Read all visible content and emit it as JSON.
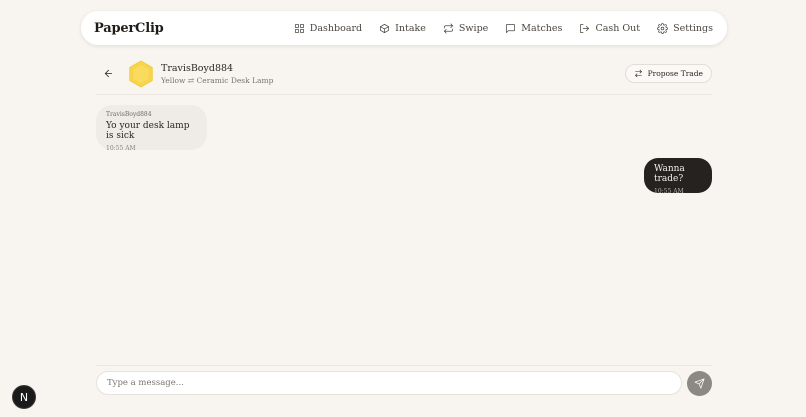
{
  "brand": "PaperClip",
  "nav": [
    {
      "label": "Dashboard",
      "icon": "dashboard-icon"
    },
    {
      "label": "Intake",
      "icon": "box-icon"
    },
    {
      "label": "Swipe",
      "icon": "repeat-icon"
    },
    {
      "label": "Matches",
      "icon": "message-icon"
    },
    {
      "label": "Cash Out",
      "icon": "logout-icon"
    },
    {
      "label": "Settings",
      "icon": "gear-icon"
    }
  ],
  "chat": {
    "partner_name": "TravisBoyd884",
    "trade_summary": "Yellow ⇄ Ceramic Desk Lamp",
    "avatar_color": "#f7d54a",
    "propose_label": "Propose Trade"
  },
  "messages": [
    {
      "direction": "incoming",
      "sender": "TravisBoyd884",
      "text": "Yo your desk lamp is sick",
      "time": "10:55 AM"
    },
    {
      "direction": "outgoing",
      "text": "Wanna trade?",
      "time": "10:55 AM"
    }
  ],
  "composer": {
    "placeholder": "Type a message...",
    "value": ""
  },
  "badge": {
    "letter": "N"
  },
  "colors": {
    "background": "#f8f4f0",
    "outgoing_bubble": "#26221f",
    "incoming_bubble": "#efebe7",
    "send_button": "#8d8883"
  }
}
